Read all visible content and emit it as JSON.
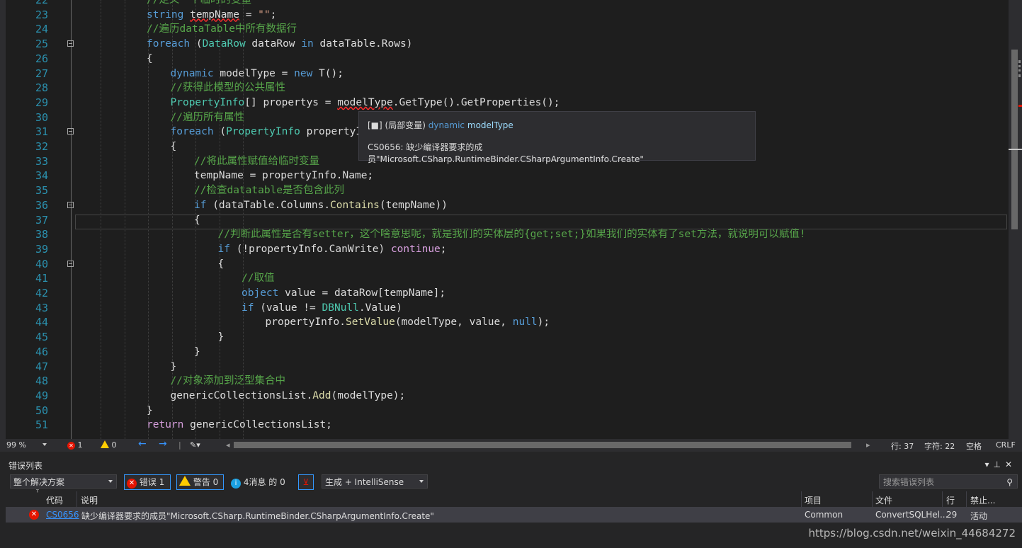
{
  "editor": {
    "lines": [
      {
        "n": "22",
        "segs": [
          {
            "c": "t-cm",
            "t": "//定义一个临时的变量"
          }
        ],
        "indent": 3
      },
      {
        "n": "23",
        "segs": [
          {
            "c": "t-kw",
            "t": "string"
          },
          {
            "c": "t-plain",
            "t": " "
          },
          {
            "c": "t-id squiggle",
            "t": "tempName"
          },
          {
            "c": "t-plain",
            "t": " = "
          },
          {
            "c": "t-str",
            "t": "\"\""
          },
          {
            "c": "t-plain",
            "t": ";"
          }
        ],
        "indent": 3
      },
      {
        "n": "24",
        "segs": [
          {
            "c": "t-cm",
            "t": "//遍历dataTable中所有数据行"
          }
        ],
        "indent": 3
      },
      {
        "n": "25",
        "fold": true,
        "segs": [
          {
            "c": "t-kw",
            "t": "foreach"
          },
          {
            "c": "t-plain",
            "t": " ("
          },
          {
            "c": "t-type",
            "t": "DataRow"
          },
          {
            "c": "t-plain",
            "t": " "
          },
          {
            "c": "t-id",
            "t": "dataRow"
          },
          {
            "c": "t-plain",
            "t": " "
          },
          {
            "c": "t-kw",
            "t": "in"
          },
          {
            "c": "t-plain",
            "t": " dataTable.Rows)"
          }
        ],
        "indent": 3
      },
      {
        "n": "26",
        "segs": [
          {
            "c": "t-plain",
            "t": "{"
          }
        ],
        "indent": 3
      },
      {
        "n": "27",
        "segs": [
          {
            "c": "t-kw",
            "t": "dynamic"
          },
          {
            "c": "t-plain",
            "t": " modelType = "
          },
          {
            "c": "t-kw",
            "t": "new"
          },
          {
            "c": "t-plain",
            "t": " T();"
          }
        ],
        "indent": 4
      },
      {
        "n": "28",
        "segs": [
          {
            "c": "t-cm",
            "t": "//获得此模型的公共属性"
          }
        ],
        "indent": 4
      },
      {
        "n": "29",
        "segs": [
          {
            "c": "t-type",
            "t": "PropertyInfo"
          },
          {
            "c": "t-plain",
            "t": "[] propertys = "
          },
          {
            "c": "t-id squiggle",
            "t": "modelType"
          },
          {
            "c": "t-plain",
            "t": ".GetType().GetProperties();"
          }
        ],
        "indent": 4
      },
      {
        "n": "30",
        "segs": [
          {
            "c": "t-cm",
            "t": "//遍历所有属性"
          }
        ],
        "indent": 4
      },
      {
        "n": "31",
        "fold": true,
        "segs": [
          {
            "c": "t-kw",
            "t": "foreach"
          },
          {
            "c": "t-plain",
            "t": " ("
          },
          {
            "c": "t-type",
            "t": "PropertyInfo"
          },
          {
            "c": "t-plain",
            "t": " propertyIn"
          }
        ],
        "indent": 4
      },
      {
        "n": "32",
        "segs": [
          {
            "c": "t-plain",
            "t": "{"
          }
        ],
        "indent": 4
      },
      {
        "n": "33",
        "segs": [
          {
            "c": "t-cm",
            "t": "//将此属性赋值给临时变量"
          }
        ],
        "indent": 5
      },
      {
        "n": "34",
        "segs": [
          {
            "c": "t-plain",
            "t": "tempName = propertyInfo.Name;"
          }
        ],
        "indent": 5
      },
      {
        "n": "35",
        "segs": [
          {
            "c": "t-cm",
            "t": "//检查datatable是否包含此列"
          }
        ],
        "indent": 5
      },
      {
        "n": "36",
        "fold": true,
        "segs": [
          {
            "c": "t-kw",
            "t": "if"
          },
          {
            "c": "t-plain",
            "t": " (dataTable.Columns."
          },
          {
            "c": "t-m",
            "t": "Contains"
          },
          {
            "c": "t-plain",
            "t": "(tempName))"
          }
        ],
        "indent": 5
      },
      {
        "n": "37",
        "segs": [
          {
            "c": "t-plain",
            "t": "{"
          }
        ],
        "indent": 5
      },
      {
        "n": "38",
        "segs": [
          {
            "c": "t-cm",
            "t": "//判断此属性是否有setter，这个啥意思呢，就是我们的实体层的{get;set;}如果我们的实体有了set方法，就说明可以赋值!"
          }
        ],
        "indent": 6
      },
      {
        "n": "39",
        "segs": [
          {
            "c": "t-kw",
            "t": "if"
          },
          {
            "c": "t-plain",
            "t": " (!propertyInfo.CanWrite) "
          },
          {
            "c": "t-ctl",
            "t": "continue"
          },
          {
            "c": "t-plain",
            "t": ";"
          }
        ],
        "indent": 6
      },
      {
        "n": "40",
        "fold": true,
        "segs": [
          {
            "c": "t-plain",
            "t": "{"
          }
        ],
        "indent": 6
      },
      {
        "n": "41",
        "segs": [
          {
            "c": "t-cm",
            "t": "//取值"
          }
        ],
        "indent": 7
      },
      {
        "n": "42",
        "segs": [
          {
            "c": "t-kw",
            "t": "object"
          },
          {
            "c": "t-plain",
            "t": " value = dataRow[tempName];"
          }
        ],
        "indent": 7
      },
      {
        "n": "43",
        "segs": [
          {
            "c": "t-kw",
            "t": "if"
          },
          {
            "c": "t-plain",
            "t": " (value != "
          },
          {
            "c": "t-type",
            "t": "DBNull"
          },
          {
            "c": "t-plain",
            "t": ".Value)"
          }
        ],
        "indent": 7
      },
      {
        "n": "44",
        "segs": [
          {
            "c": "t-plain",
            "t": "propertyInfo."
          },
          {
            "c": "t-m",
            "t": "SetValue"
          },
          {
            "c": "t-plain",
            "t": "(modelType, value, "
          },
          {
            "c": "t-kw",
            "t": "null"
          },
          {
            "c": "t-plain",
            "t": ");"
          }
        ],
        "indent": 8
      },
      {
        "n": "45",
        "segs": [
          {
            "c": "t-plain",
            "t": "}"
          }
        ],
        "indent": 6
      },
      {
        "n": "46",
        "segs": [
          {
            "c": "t-plain",
            "t": "}"
          }
        ],
        "indent": 5
      },
      {
        "n": "47",
        "segs": [
          {
            "c": "t-plain",
            "t": "}"
          }
        ],
        "indent": 4
      },
      {
        "n": "48",
        "segs": [
          {
            "c": "t-cm",
            "t": "//对象添加到泛型集合中"
          }
        ],
        "indent": 4
      },
      {
        "n": "49",
        "segs": [
          {
            "c": "t-plain",
            "t": "genericCollectionsList."
          },
          {
            "c": "t-m",
            "t": "Add"
          },
          {
            "c": "t-plain",
            "t": "(modelType);"
          }
        ],
        "indent": 4
      },
      {
        "n": "50",
        "segs": [
          {
            "c": "t-plain",
            "t": "}"
          }
        ],
        "indent": 3
      },
      {
        "n": "51",
        "segs": [
          {
            "c": "t-ctl",
            "t": "return"
          },
          {
            "c": "t-plain",
            "t": " genericCollectionsList;"
          }
        ],
        "indent": 3
      }
    ]
  },
  "tooltip": {
    "scope": "(局部变量)",
    "type_kw": "dynamic",
    "var_name": "modelType",
    "error": "CS0656: 缺少编译器要求的成员\"Microsoft.CSharp.RuntimeBinder.CSharpArgumentInfo.Create\""
  },
  "status": {
    "zoom": "99 %",
    "errors": "1",
    "warnings": "0",
    "line": "行: 37",
    "char": "字符: 22",
    "spaces": "空格",
    "eol": "CRLF"
  },
  "error_list": {
    "title": "错误列表",
    "scope": "整个解决方案",
    "errors_btn": "错误 1",
    "warnings_btn": "警告 0",
    "messages_btn": "4消息 的 0",
    "build_filter": "生成 + IntelliSense",
    "search_placeholder": "搜索错误列表",
    "columns": {
      "code": "代码",
      "description": "说明",
      "project": "项目",
      "file": "文件",
      "line": "行",
      "suppression": "禁止..."
    },
    "rows": [
      {
        "code": "CS0656",
        "description": "缺少编译器要求的成员\"Microsoft.CSharp.RuntimeBinder.CSharpArgumentInfo.Create\"",
        "project": "Common",
        "file": "ConvertSQLHel...",
        "line": "29",
        "suppression": "活动"
      }
    ]
  },
  "watermark": "https://blog.csdn.net/weixin_44684272",
  "colors": {
    "keyword": "#569cd6",
    "type": "#4ec9b0",
    "comment": "#57a64a",
    "line_number": "#2b91af",
    "error": "#e51400"
  }
}
